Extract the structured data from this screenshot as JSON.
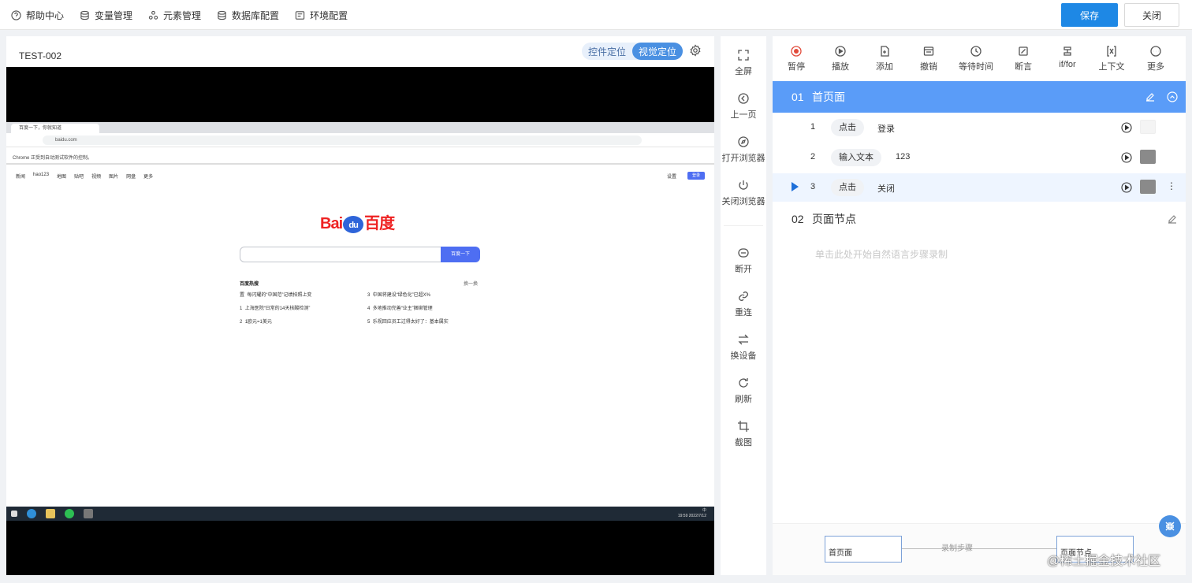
{
  "topnav": {
    "items": [
      {
        "label": "帮助中心",
        "icon": "help-icon"
      },
      {
        "label": "变量管理",
        "icon": "database-icon"
      },
      {
        "label": "元素管理",
        "icon": "elements-icon"
      },
      {
        "label": "数据库配置",
        "icon": "database-icon"
      },
      {
        "label": "环境配置",
        "icon": "environment-icon"
      }
    ],
    "save_label": "保存",
    "close_label": "关闭",
    "accent": "#1e88e5"
  },
  "device": {
    "title": "TEST-002",
    "locate_modes": [
      "控件定位",
      "视觉定位"
    ],
    "active_mode": "视觉定位",
    "browser": {
      "tab_title": "百度一下，你就知道",
      "address": "baidu.com",
      "info_bar": "Chrome 正受到自动测试软件的控制。",
      "nav": [
        "新闻",
        "hao123",
        "地图",
        "贴吧",
        "视频",
        "图片",
        "网盘",
        "更多"
      ],
      "settings": "设置",
      "login": "登录",
      "logo": {
        "left": "Bai",
        "mid": "du",
        "right": "百度"
      },
      "search_button": "百度一下",
      "hot_title": "百度热搜",
      "hot_refresh": "换一换",
      "hot_items": [
        {
          "rank": "置",
          "text": "每闪耀的“中国范”记绩拍照上变"
        },
        {
          "rank": "1",
          "text": "上海医院“日常的14天核酸检测”"
        },
        {
          "rank": "2",
          "text": "1欧元=1美元"
        },
        {
          "rank": "3",
          "text": "中国将建设“绿色化”已超X%"
        },
        {
          "rank": "4",
          "text": "多地推动完善“业主”捆绑管理"
        },
        {
          "rank": "5",
          "text": "乐视回应员工过得太好了：基本属实"
        }
      ],
      "time": "19:59",
      "date": "2022/7/12",
      "tray_lang": "中"
    }
  },
  "tools": [
    {
      "label": "全屏",
      "icon": "fullscreen-icon"
    },
    {
      "label": "上一页",
      "icon": "back-icon"
    },
    {
      "label": "打开浏览器",
      "icon": "compass-icon"
    },
    {
      "label": "关闭浏览器",
      "icon": "power-icon"
    },
    {
      "label": "断开",
      "icon": "disconnect-icon"
    },
    {
      "label": "重连",
      "icon": "link-icon"
    },
    {
      "label": "换设备",
      "icon": "swap-icon"
    },
    {
      "label": "刷新",
      "icon": "refresh-icon"
    },
    {
      "label": "截图",
      "icon": "crop-icon"
    }
  ],
  "actions": [
    {
      "label": "暂停",
      "icon": "record-icon"
    },
    {
      "label": "播放",
      "icon": "play-icon"
    },
    {
      "label": "添加",
      "icon": "add-icon"
    },
    {
      "label": "撤销",
      "icon": "undo-icon"
    },
    {
      "label": "等待时间",
      "icon": "clock-icon"
    },
    {
      "label": "断言",
      "icon": "assert-icon"
    },
    {
      "label": "if/for",
      "icon": "branch-icon"
    },
    {
      "label": "上下文",
      "icon": "context-icon"
    },
    {
      "label": "更多",
      "icon": "more-icon"
    }
  ],
  "sections": [
    {
      "num": "01",
      "title": "首页面",
      "steps": [
        {
          "idx": "1",
          "action": "点击",
          "value": "登录"
        },
        {
          "idx": "2",
          "action": "输入文本",
          "value": "123"
        },
        {
          "idx": "3",
          "action": "点击",
          "value": "关闭"
        }
      ]
    },
    {
      "num": "02",
      "title": "页面节点",
      "placeholder": "单击此处开始自然语言步骤录制"
    }
  ],
  "flow": {
    "nodes": [
      "首页面",
      "页面节点"
    ],
    "edge_label": "录制步骤"
  },
  "watermark": "@稀土掘金技术社区"
}
